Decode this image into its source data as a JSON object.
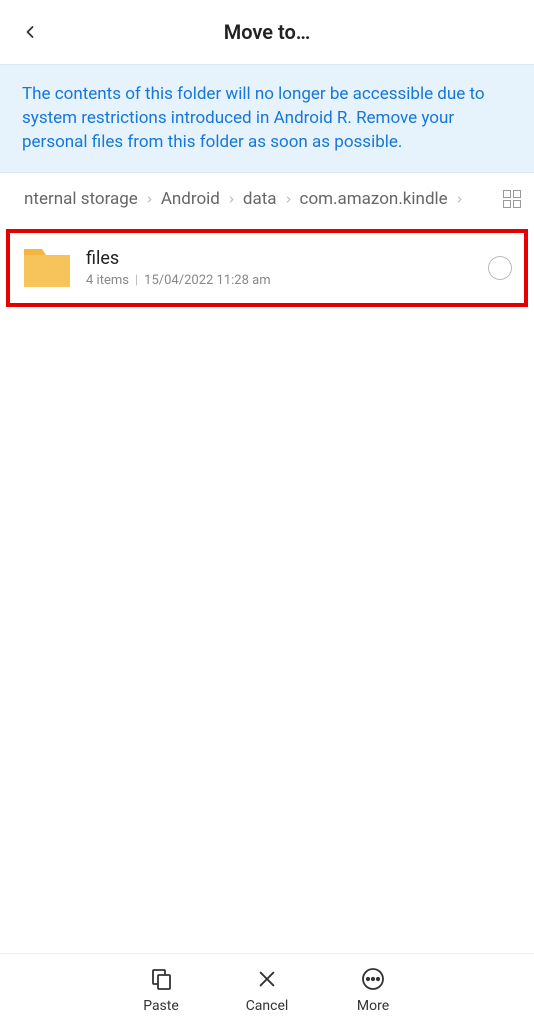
{
  "header": {
    "title": "Move to…"
  },
  "banner": {
    "text": "The contents of this folder will no longer be accessible due to system restrictions introduced in Android R. Remove your personal files from this folder as soon as possible."
  },
  "breadcrumb": {
    "items": [
      "nternal storage",
      "Android",
      "data",
      "com.amazon.kindle"
    ]
  },
  "list": {
    "items": [
      {
        "name": "files",
        "count": "4 items",
        "date": "15/04/2022 11:28 am"
      }
    ]
  },
  "footer": {
    "paste": "Paste",
    "cancel": "Cancel",
    "more": "More"
  }
}
